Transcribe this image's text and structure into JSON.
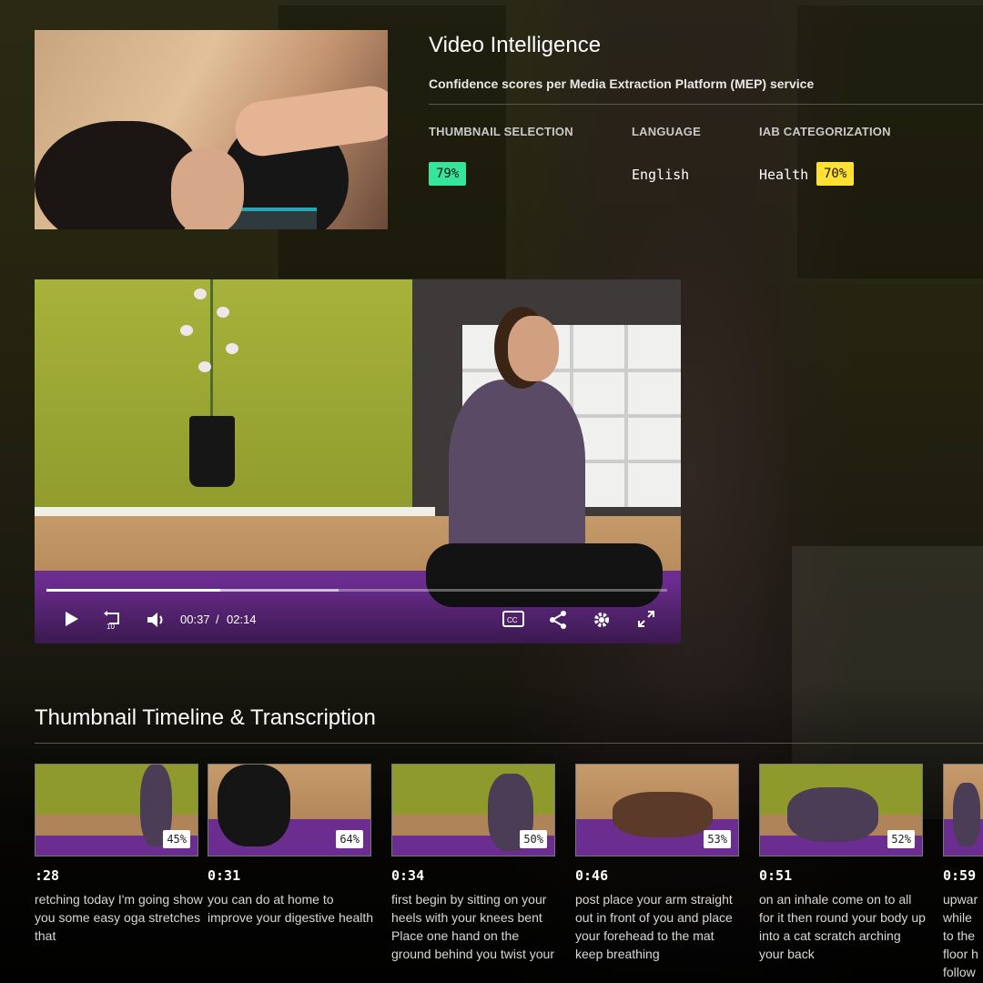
{
  "header": {
    "title": "Video Intelligence",
    "subtitle": "Confidence scores per Media Extraction Platform (MEP) service"
  },
  "scores": {
    "thumbnail": {
      "label": "THUMBNAIL SELECTION",
      "value": "79%",
      "color": "#35e69a"
    },
    "language": {
      "label": "LANGUAGE",
      "value": "English"
    },
    "iab": {
      "label": "IAB CATEGORIZATION",
      "category": "Health",
      "value": "70%",
      "color": "#ffe033"
    }
  },
  "player": {
    "current_time": "00:37",
    "separator": "/",
    "duration": "02:14",
    "progress": 0.28,
    "buffered": 0.47,
    "icons": [
      "play-icon",
      "rewind-10-icon",
      "volume-icon",
      "closed-captions-icon",
      "share-icon",
      "settings-icon",
      "fullscreen-icon"
    ]
  },
  "timeline": {
    "title": "Thumbnail Timeline & Transcription",
    "items": [
      {
        "time": ":28",
        "score": "45%",
        "text": "retching today I'm going show you some easy oga stretches that"
      },
      {
        "time": "0:31",
        "score": "64%",
        "text": "you can do at home to improve your digestive health"
      },
      {
        "time": "0:34",
        "score": "50%",
        "text": "first begin by sitting on your heels with your knees bent Place one hand on the ground behind you twist your"
      },
      {
        "time": "0:46",
        "score": "53%",
        "text": "post place your arm straight out in front of you and place your forehead to the mat keep breathing"
      },
      {
        "time": "0:51",
        "score": "52%",
        "text": "on an inhale come on to all for it then round your body up into a cat scratch arching your back"
      },
      {
        "time": "0:59",
        "score": "",
        "text": "upwar while to the floor h follow"
      }
    ]
  }
}
